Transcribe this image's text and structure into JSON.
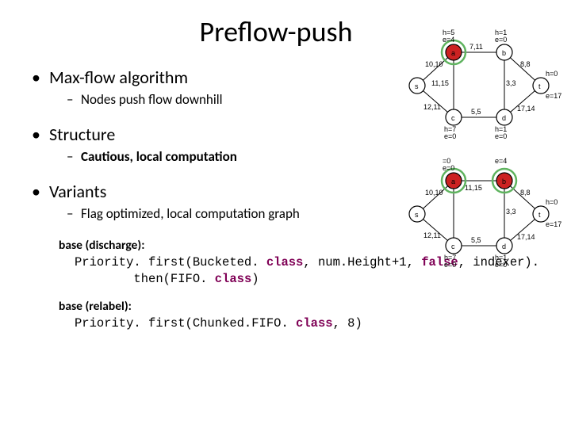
{
  "title": "Preflow-push",
  "bullets": [
    {
      "text": "Max-flow algorithm",
      "sub": {
        "text": "Nodes push flow downhill",
        "bold": false
      }
    },
    {
      "text": "Structure",
      "sub": {
        "text": "Cautious, local computation",
        "bold": true
      }
    },
    {
      "text": "Variants",
      "sub": {
        "text": "Flag optimized, local computation graph",
        "bold": false
      }
    }
  ],
  "code": {
    "discharge": {
      "label": "base (discharge):",
      "line1_pre": "Priority. first(Bucketed. ",
      "line1_kw": "class",
      "line1_mid": ", num.Height+1, ",
      "line1_lit": "false",
      "line1_post": ", indexer).",
      "line2_pre": "then(FIFO. ",
      "line2_kw": "class",
      "line2_post": ")"
    },
    "relabel": {
      "label": "base (relabel):",
      "line1_pre": "Priority. first(Chunked.FIFO. ",
      "line1_kw": "class",
      "line1_post": ", 8)"
    }
  },
  "graph": {
    "a": {
      "letter": "a",
      "h": "h=5",
      "e": "e=4"
    },
    "b": {
      "letter": "b",
      "h": "h=1",
      "e": "e=0"
    },
    "c": {
      "letter": "c",
      "h": "h=7",
      "e": "e=0"
    },
    "d": {
      "letter": "d",
      "h": "h=1",
      "e": "e=0"
    },
    "s": {
      "letter": "s",
      "h": "h=",
      "e": ""
    },
    "t": {
      "letter": "t",
      "h": "h=0",
      "e": "e=17"
    },
    "sa": "10,10",
    "sc": "12,11",
    "ab": "7,11",
    "ac": "11,15",
    "cd": "5,5",
    "bt": "8,8",
    "bd": "3,3",
    "dt": "17,14"
  }
}
